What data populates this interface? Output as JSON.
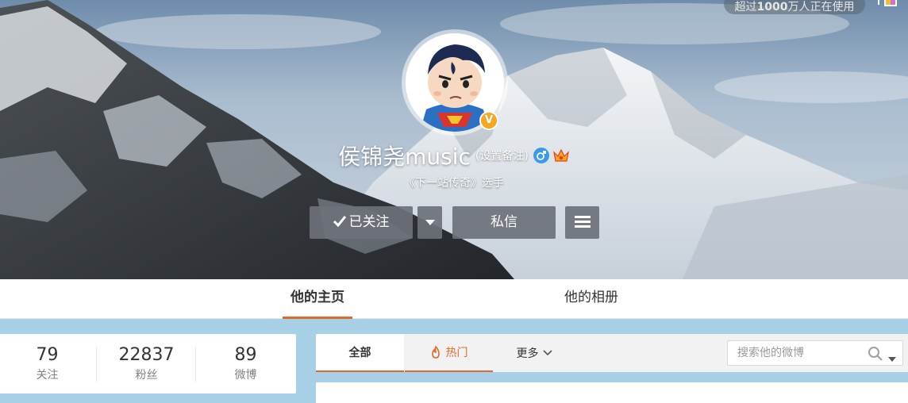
{
  "banner": {
    "users_prefix": "超过",
    "users_count": "1000",
    "users_suffix": "万人正在使用"
  },
  "profile": {
    "name": "侯锦尧music",
    "remark_label": "(设置备注)",
    "intro": "《下一站传奇》选手",
    "verified_badge": "V",
    "gender": "male"
  },
  "actions": {
    "follow_label": "已关注",
    "message_label": "私信"
  },
  "tabs": [
    {
      "label": "他的主页",
      "active": true
    },
    {
      "label": "他的相册",
      "active": false
    }
  ],
  "stats": [
    {
      "value": "79",
      "label": "关注"
    },
    {
      "value": "22837",
      "label": "粉丝"
    },
    {
      "value": "89",
      "label": "微博"
    }
  ],
  "feed_tabs": {
    "all_label": "全部",
    "hot_label": "热门",
    "more_label": "更多"
  },
  "search": {
    "placeholder": "搜索他的微博",
    "value": ""
  },
  "colors": {
    "accent": "#e06a2c",
    "verified": "#f5a623",
    "page_bg": "#a7cfe6"
  }
}
